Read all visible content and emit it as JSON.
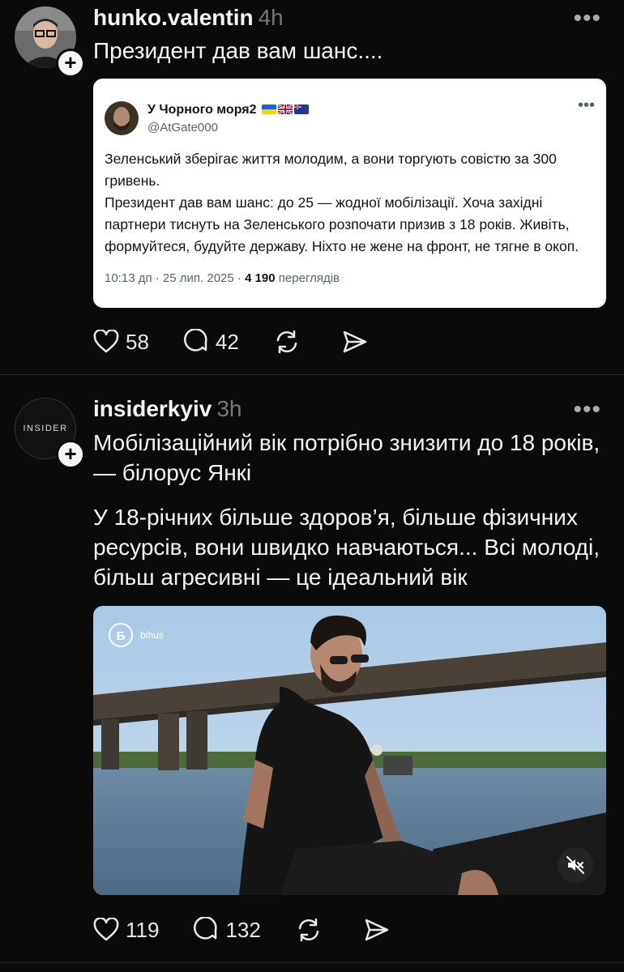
{
  "post1": {
    "username": "hunko.valentin",
    "time": "4h",
    "text": "Президент дав вам шанс....",
    "quote": {
      "name": "У Чорного моря2",
      "handle": "@AtGate000",
      "body": "Зеленський зберігає життя молодим, а вони торгують совістю за 300 гривень.\nПрезидент дав вам шанс: до 25 — жодної мобілізації. Хоча західні партнери тиснуть на Зеленського розпочати призив з 18 років. Живіть, формуйтеся, будуйте державу. Ніхто не жене на фронт, не тягне в окоп.",
      "meta_time": "10:13 дп · 25 лип. 2025 · ",
      "views": "4 190",
      "views_label": " переглядів"
    },
    "likes": "58",
    "comments": "42"
  },
  "post2": {
    "username": "insiderkyiv",
    "time": "3h",
    "avatar_text": "INSIDER",
    "text1": "Мобілізаційний вік потрібно знизити до 18 років, — білорус Янкі",
    "text2": "У 18-річних більше здоров’я, більше фізичних ресурсів, вони швидко навчаються... Всі молоді, більш агресивні — це ідеальний вік",
    "video_watermark": "bihus",
    "video_logo": "Б",
    "likes": "119",
    "comments": "132"
  },
  "icons": {
    "heart": "heart-icon",
    "comment": "comment-icon",
    "repost": "repost-icon",
    "share": "share-icon",
    "more": "more-icon",
    "mute": "mute-icon"
  },
  "more_glyph": "•••"
}
